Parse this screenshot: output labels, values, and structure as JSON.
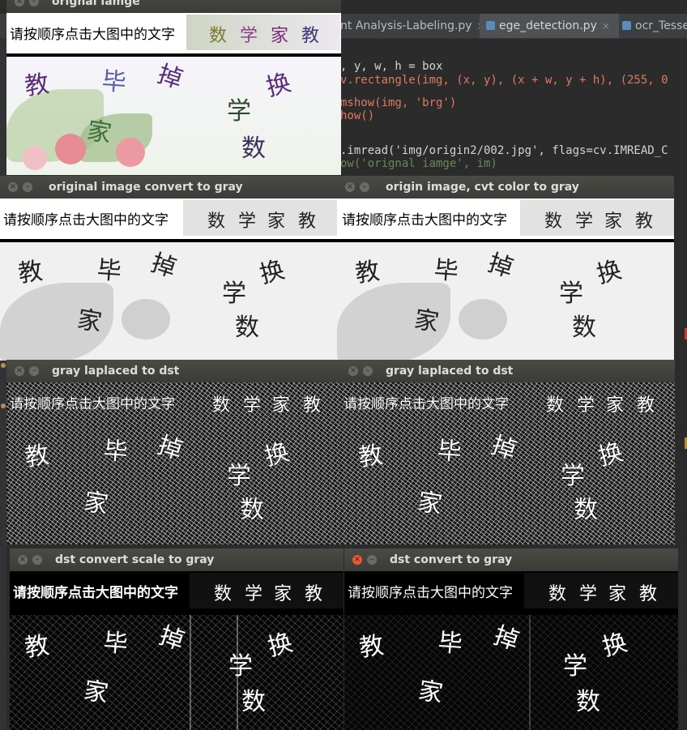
{
  "ide": {
    "tabs": [
      {
        "label": "nt Analysis-Labeling.py",
        "close": "×"
      },
      {
        "label": "ege_detection.py",
        "close": "×"
      },
      {
        "label": "ocr_Tesser"
      }
    ],
    "code_lines": [
      ", y, w, h = box",
      "v.rectangle(img, (x, y), (x + w, y + h), (255, 0",
      "",
      "mshow(img, 'brg')",
      "how()",
      "",
      "",
      ".imread('img/origin2/002.jpg', flags=cv.IMREAD_C",
      "ow('orignal iamge', im)"
    ],
    "colors": {
      "editor_bg": "#2b2b2b",
      "tab_bar": "#3c3f41",
      "keyword": "#cc7832",
      "string": "#6a8759",
      "param": "#aa4926"
    }
  },
  "captcha": {
    "prompt": "请按顺序点击大图中的文字",
    "target_words": [
      "数",
      "学",
      "家",
      "教"
    ],
    "scene_chars": [
      "教",
      "毕",
      "掉",
      "换",
      "学",
      "家",
      "数"
    ]
  },
  "windows": [
    {
      "id": "w1",
      "title": "orignal iamge",
      "style": "color",
      "close_style": "gray"
    },
    {
      "id": "w2",
      "title": "original image convert to gray",
      "style": "gray",
      "close_style": "gray"
    },
    {
      "id": "w3",
      "title": "origin image, cvt color to gray",
      "style": "gray",
      "close_style": "gray"
    },
    {
      "id": "w4",
      "title": "gray laplaced to dst",
      "style": "laplace",
      "close_style": "gray"
    },
    {
      "id": "w5",
      "title": "gray laplaced to dst",
      "style": "laplace",
      "close_style": "gray"
    },
    {
      "id": "w6",
      "title": "dst convert scale to gray",
      "style": "dark",
      "close_style": "gray"
    },
    {
      "id": "w7",
      "title": "dst convert to gray",
      "style": "dark",
      "close_style": "red"
    }
  ],
  "icons": {
    "close": "close-icon",
    "minimize": "minimize-icon",
    "file": "python-file-icon"
  }
}
